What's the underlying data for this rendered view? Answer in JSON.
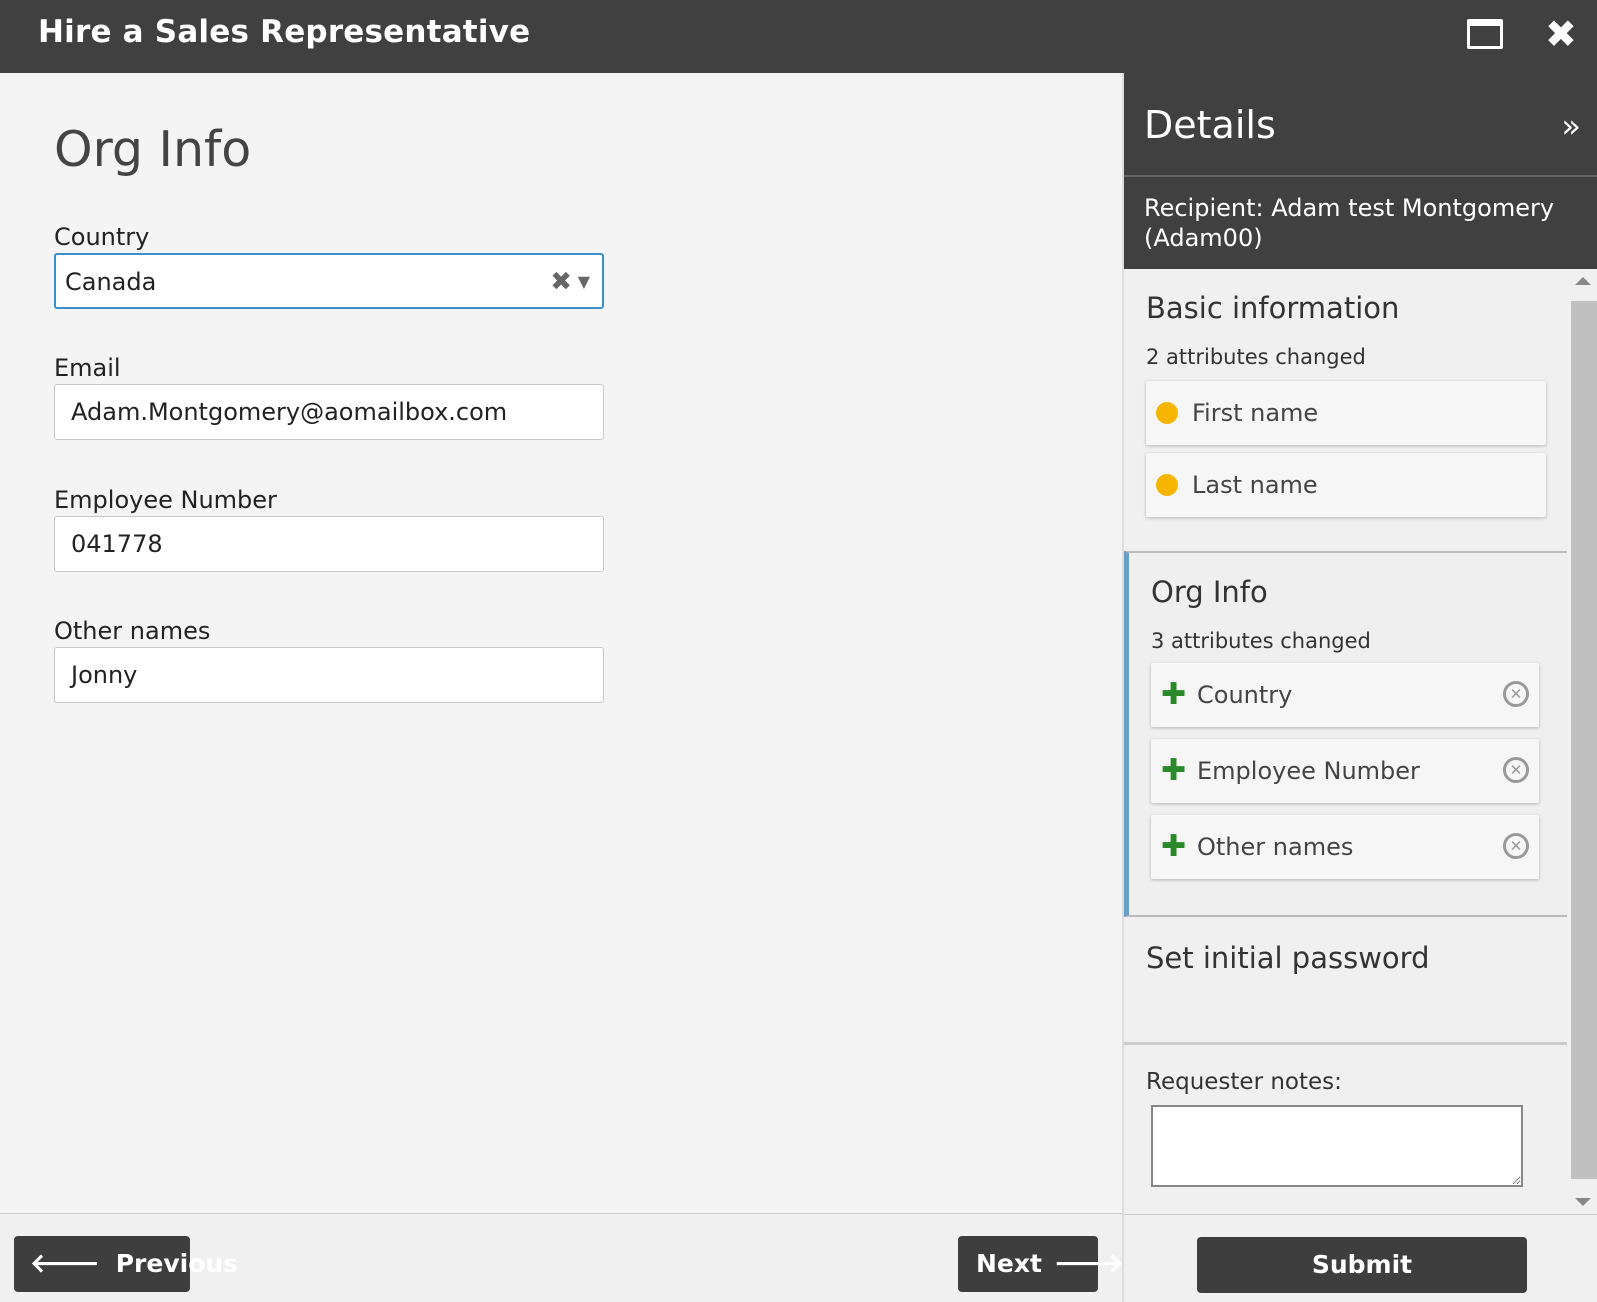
{
  "window": {
    "title": "Hire a Sales Representative",
    "maximize_icon": "window-maximize-icon",
    "close_glyph": "✖"
  },
  "form": {
    "page_title": "Org Info",
    "country": {
      "label": "Country",
      "value": "Canada",
      "clear_glyph": "✖",
      "caret_glyph": "▼"
    },
    "email": {
      "label": "Email",
      "value": "Adam.Montgomery@aomailbox.com"
    },
    "employee_number": {
      "label": "Employee Number",
      "value": "041778"
    },
    "other_names": {
      "label": "Other names",
      "value": "Jonny"
    }
  },
  "footer": {
    "previous_label": "Previous",
    "next_label": "Next",
    "arrow_left": "🡐",
    "arrow_right": "🡒"
  },
  "details": {
    "title": "Details",
    "collapse_glyph": "»",
    "recipient": "Recipient: Adam test Montgomery (Adam00)",
    "sections": {
      "basic": {
        "title": "Basic information",
        "count": "2 attributes changed",
        "items": [
          "First name",
          "Last name"
        ]
      },
      "org": {
        "title": "Org Info",
        "count": "3 attributes changed",
        "items": [
          "Country",
          "Employee Number",
          "Other names"
        ]
      },
      "password": {
        "title": "Set initial password"
      }
    },
    "plus_glyph": "✚",
    "remove_glyph": "✕",
    "notes_label": "Requester notes:",
    "submit_label": "Submit"
  },
  "colors": {
    "titlebar": "#404040",
    "focus_border": "#3a8fd0",
    "changed_dot": "#f7b500",
    "added_plus": "#2a8a2a",
    "active_section_accent": "#6a9fc8"
  }
}
